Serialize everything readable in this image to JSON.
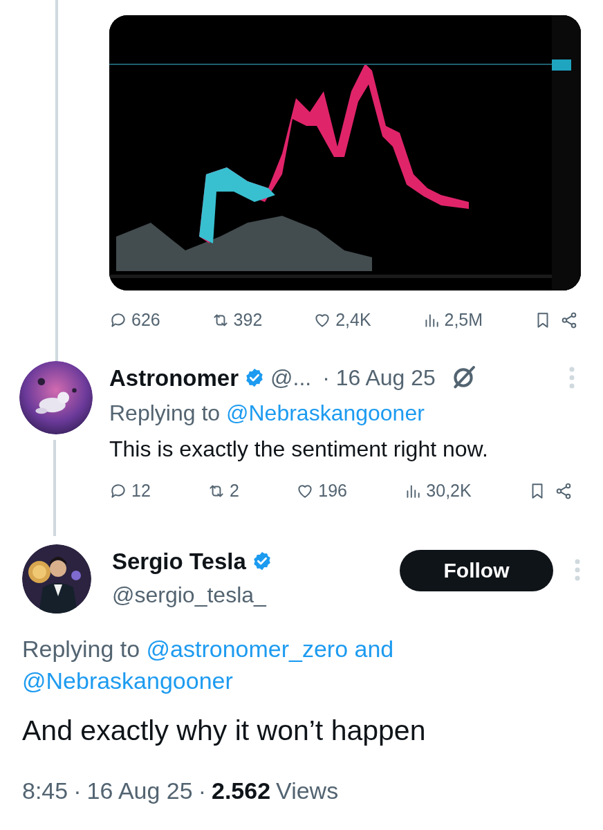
{
  "post": {
    "stats": [
      {
        "kind": "reply",
        "count": "626"
      },
      {
        "kind": "repost",
        "count": "392"
      },
      {
        "kind": "like",
        "count": "2,4K"
      },
      {
        "kind": "views",
        "count": "2,5M"
      }
    ]
  },
  "reply": {
    "name": "Astronomer",
    "verified": true,
    "handle": "@...",
    "time": "· 16 Aug 25",
    "replying_label": "Replying to",
    "mentions": [
      "@Nebraskangooner"
    ],
    "text": "This is exactly the sentiment right now.",
    "stats": [
      {
        "kind": "reply",
        "count": "12"
      },
      {
        "kind": "repost",
        "count": "2"
      },
      {
        "kind": "like",
        "count": "196"
      },
      {
        "kind": "views",
        "count": "30,2K"
      }
    ]
  },
  "main": {
    "name": "Sergio Tesla",
    "verified": true,
    "handle": "@sergio_tesla_",
    "follow_label": "Follow",
    "replying_label": "Replying to",
    "mentions": [
      "@astronomer_zero and",
      "@Nebraskangooner"
    ],
    "text": "And exactly why it won’t happen",
    "footer": [
      {
        "kind": "time",
        "text": "8:45"
      },
      {
        "kind": "dot",
        "text": "·"
      },
      {
        "kind": "date",
        "text": "16 Aug 25"
      },
      {
        "kind": "dot",
        "text": "·"
      },
      {
        "kind": "count",
        "text": "2.562"
      },
      {
        "kind": "label",
        "text": "Views"
      }
    ]
  }
}
